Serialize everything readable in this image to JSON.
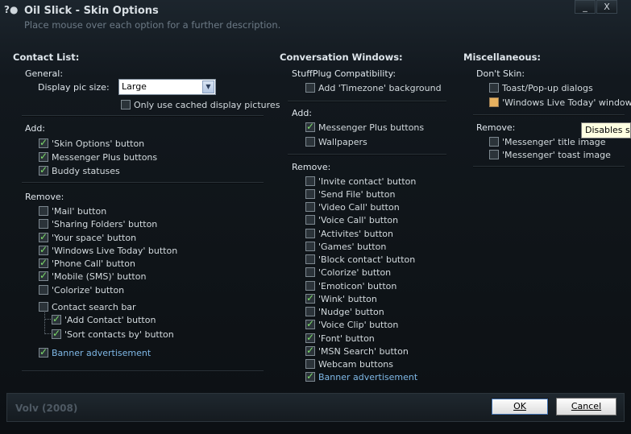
{
  "window": {
    "title": "Oil Slick - Skin Options",
    "subtitle": "Place mouse over each option for a further description.",
    "minimize_label": "_",
    "close_label": "X"
  },
  "contact_list": {
    "header": "Contact List:",
    "general_label": "General:",
    "display_pic_label": "Display pic size:",
    "display_pic_value": "Large",
    "cached_pics": {
      "label": "Only use cached display pictures",
      "checked": false
    },
    "add_label": "Add:",
    "add_items": [
      {
        "label": "'Skin Options' button",
        "checked": true
      },
      {
        "label": "Messenger Plus buttons",
        "checked": true
      },
      {
        "label": "Buddy statuses",
        "checked": true
      }
    ],
    "remove_label": "Remove:",
    "remove_items": [
      {
        "label": "'Mail' button",
        "checked": false
      },
      {
        "label": "'Sharing Folders' button",
        "checked": false
      },
      {
        "label": "'Your space' button",
        "checked": true
      },
      {
        "label": "'Windows Live Today' button",
        "checked": true
      },
      {
        "label": "'Phone Call' button",
        "checked": true
      },
      {
        "label": "'Mobile (SMS)' button",
        "checked": true
      },
      {
        "label": "'Colorize' button",
        "checked": false
      }
    ],
    "contact_search": {
      "label": "Contact search bar",
      "checked": false
    },
    "search_children": [
      {
        "label": "'Add Contact' button",
        "checked": true
      },
      {
        "label": "'Sort contacts by' button",
        "checked": true
      }
    ],
    "banner": {
      "label": "Banner advertisement",
      "checked": true
    }
  },
  "conversation": {
    "header": "Conversation Windows:",
    "stuffplug_label": "StuffPlug Compatibility:",
    "timezone": {
      "label": "Add 'Timezone' background",
      "checked": false
    },
    "add_label": "Add:",
    "add_items": [
      {
        "label": "Messenger Plus buttons",
        "checked": true
      },
      {
        "label": "Wallpapers",
        "checked": false
      }
    ],
    "remove_label": "Remove:",
    "remove_items": [
      {
        "label": "'Invite contact' button",
        "checked": false
      },
      {
        "label": "'Send File' button",
        "checked": false
      },
      {
        "label": "'Video Call' button",
        "checked": false
      },
      {
        "label": "'Voice Call' button",
        "checked": false
      },
      {
        "label": "'Activites' button",
        "checked": false
      },
      {
        "label": "'Games' button",
        "checked": false
      },
      {
        "label": "'Block contact' button",
        "checked": false
      },
      {
        "label": "'Colorize' button",
        "checked": false
      },
      {
        "label": "'Emoticon' button",
        "checked": false
      },
      {
        "label": "'Wink' button",
        "checked": true
      },
      {
        "label": "'Nudge' button",
        "checked": false
      },
      {
        "label": "'Voice Clip' button",
        "checked": true
      },
      {
        "label": "'Font' button",
        "checked": true
      },
      {
        "label": "'MSN Search' button",
        "checked": true
      },
      {
        "label": "Webcam buttons",
        "checked": false
      }
    ],
    "banner": {
      "label": "Banner advertisement",
      "checked": true
    }
  },
  "misc": {
    "header": "Miscellaneous:",
    "dont_skin_label": "Don't Skin:",
    "dont_skin_items": [
      {
        "label": "Toast/Pop-up dialogs",
        "checked": false
      },
      {
        "label": "'Windows Live Today' window",
        "checked": false
      }
    ],
    "remove_label": "Remove:",
    "remove_items": [
      {
        "label": "'Messenger' title image",
        "checked": false
      },
      {
        "label": "'Messenger' toast image",
        "checked": false
      }
    ]
  },
  "tooltip": {
    "text": "Disables skin"
  },
  "footer": {
    "credit": "Volv (2008)",
    "ok_label": "OK",
    "cancel_label": "Cancel"
  },
  "colors": {
    "background": "#0e1216",
    "check_green": "#7ddc6a",
    "link_blue": "#7fb8e6",
    "hover_checkbox": "#e7b15f"
  }
}
